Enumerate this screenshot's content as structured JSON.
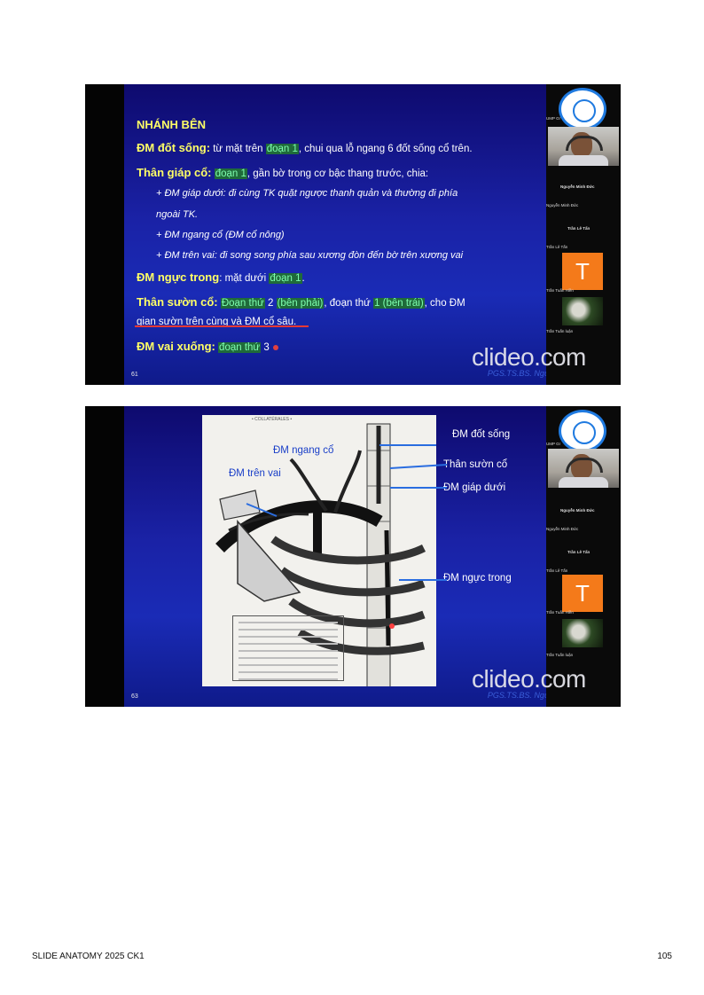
{
  "slide1": {
    "title": "NHÁNH BÊN",
    "l1_head": "ĐM đốt sống:",
    "l1_a": " từ mặt trên ",
    "l1_hl": "đoạn 1",
    "l1_b": ", chui qua lỗ ngang 6 đốt sống cổ trên.",
    "l2_head": "Thân giáp cổ:",
    "l2_hl": "đoạn 1",
    "l2_b": ", gần bờ trong cơ bậc thang trước, chia:",
    "l3": "+ ĐM giáp dưới: đi cùng TK quặt ngược thanh quản và thường đi phía",
    "l4": "ngoài TK.",
    "l5": "+ ĐM ngang cổ (ĐM cổ nông)",
    "l6": "+ ĐM trên vai: đi song song phía sau xương đòn đến bờ trên xương vai",
    "l7_head": "ĐM ngực trong",
    "l7_a": ": mặt dưới ",
    "l7_hl": "đoạn 1",
    "l7_b": ".",
    "l8_head": "Thân sườn cổ:",
    "l8_hl1": "Đoạn thứ",
    "l8_n1": " 2 ",
    "l8_hl2": "(bên phải)",
    "l8_a": ", đoạn thứ ",
    "l8_hl3": "1 (bên trái)",
    "l8_b": ", cho ĐM",
    "l9": "gian sườn trên cùng và ĐM cổ sâu.",
    "l10_head": "ĐM vai xuống:",
    "l10_hl": "đoạn thứ",
    "l10_n": " 3",
    "number": "61",
    "author": "PGS.TS.BS. Nguyễn Hoàng Vũ",
    "watermark": "clideo.com"
  },
  "slide2": {
    "label_ngang_co": "ĐM ngang cổ",
    "label_tren_vai": "ĐM trên vai",
    "label_dot_song": "ĐM đốt sống",
    "label_than_suon_co": "Thân sườn cổ",
    "label_giap_duoi": "ĐM giáp dưới",
    "label_nguc_trong": "ĐM ngực trong",
    "figure_header": "• COLLATÉRALES •",
    "number": "63",
    "author": "PGS.TS.BS. Nguyễn Hoàng Vũ",
    "watermark": "clideo.com"
  },
  "zoom": {
    "name_upper": "Nguyễn Minh Đức",
    "name_lower": "Nguyễn Minh Đức",
    "tran_le_tan_upper": "Trần Lê Tấn",
    "tran_le_tan_lower": "Trần Lê Tấn",
    "tran_tuan_hien": "Trần Tuấn Hiền",
    "tran_tuan_luan": "Trần Tuấn luận",
    "avatar_letter": "T"
  },
  "footer": {
    "left": "SLIDE ANATOMY 2025 CK1",
    "right": "105"
  }
}
